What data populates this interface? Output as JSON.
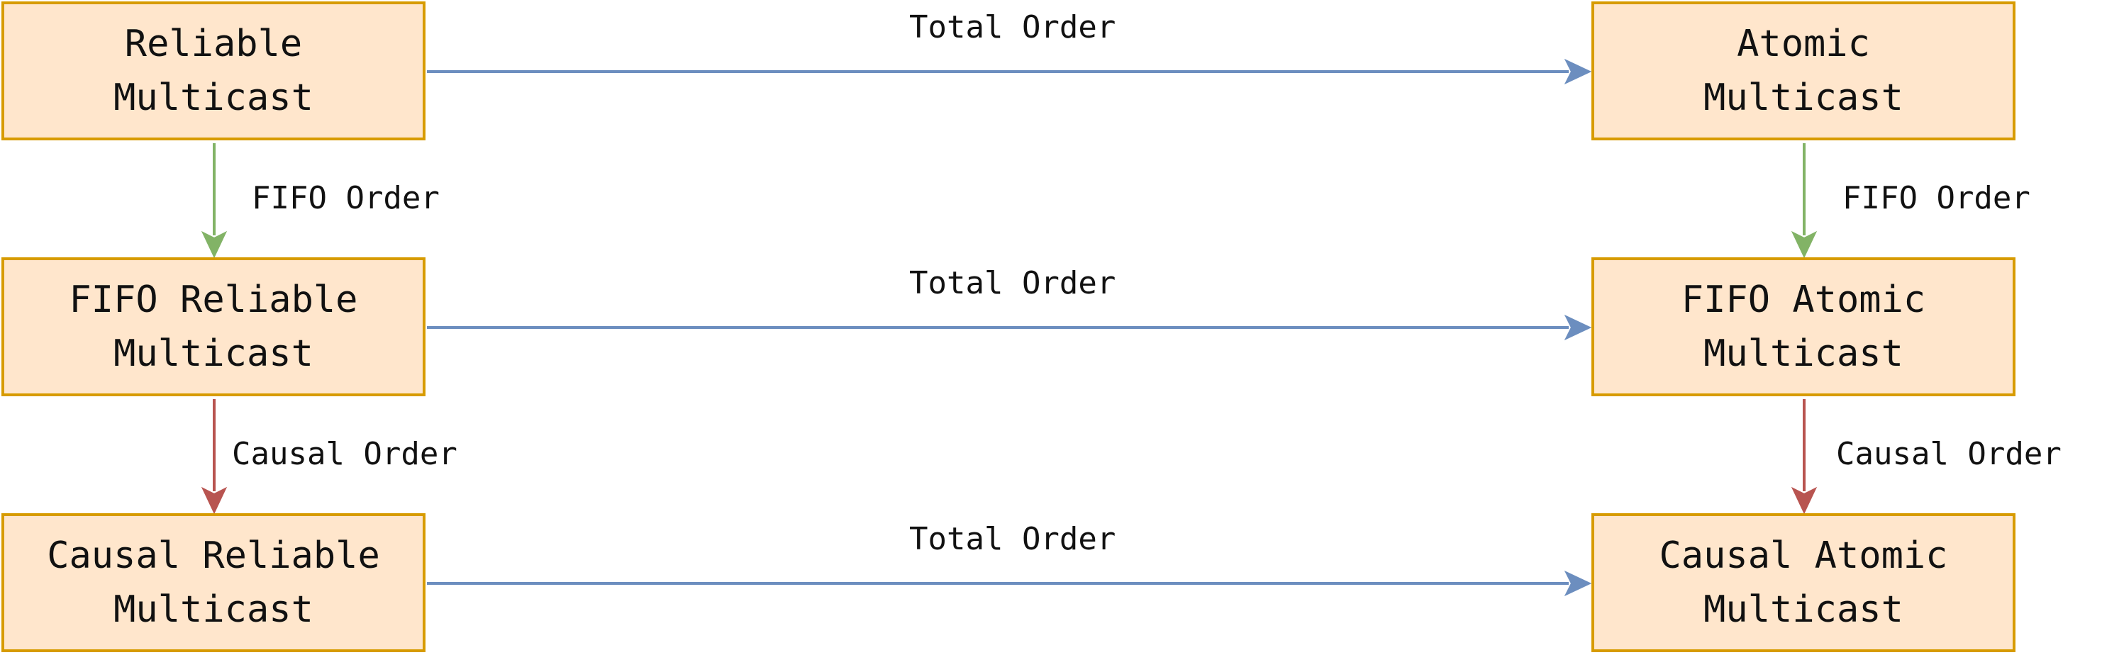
{
  "nodes": {
    "reliable": [
      "Reliable",
      "Multicast"
    ],
    "atomic": [
      "Atomic",
      "Multicast"
    ],
    "fifo_reliable": [
      "FIFO Reliable",
      "Multicast"
    ],
    "fifo_atomic": [
      "FIFO Atomic",
      "Multicast"
    ],
    "causal_reliable": [
      "Causal Reliable",
      "Multicast"
    ],
    "causal_atomic": [
      "Causal Atomic",
      "Multicast"
    ]
  },
  "edges": {
    "total_order_1": "Total Order",
    "total_order_2": "Total Order",
    "total_order_3": "Total Order",
    "fifo_order_left": "FIFO Order",
    "fifo_order_right": "FIFO Order",
    "causal_order_left": "Causal Order",
    "causal_order_right": "Causal Order"
  },
  "colors": {
    "node_fill": "#ffe6cc",
    "node_stroke": "#d79b00",
    "total_order_arrow": "#6c8ebf",
    "fifo_order_arrow": "#82b366",
    "causal_order_arrow": "#b85450"
  }
}
